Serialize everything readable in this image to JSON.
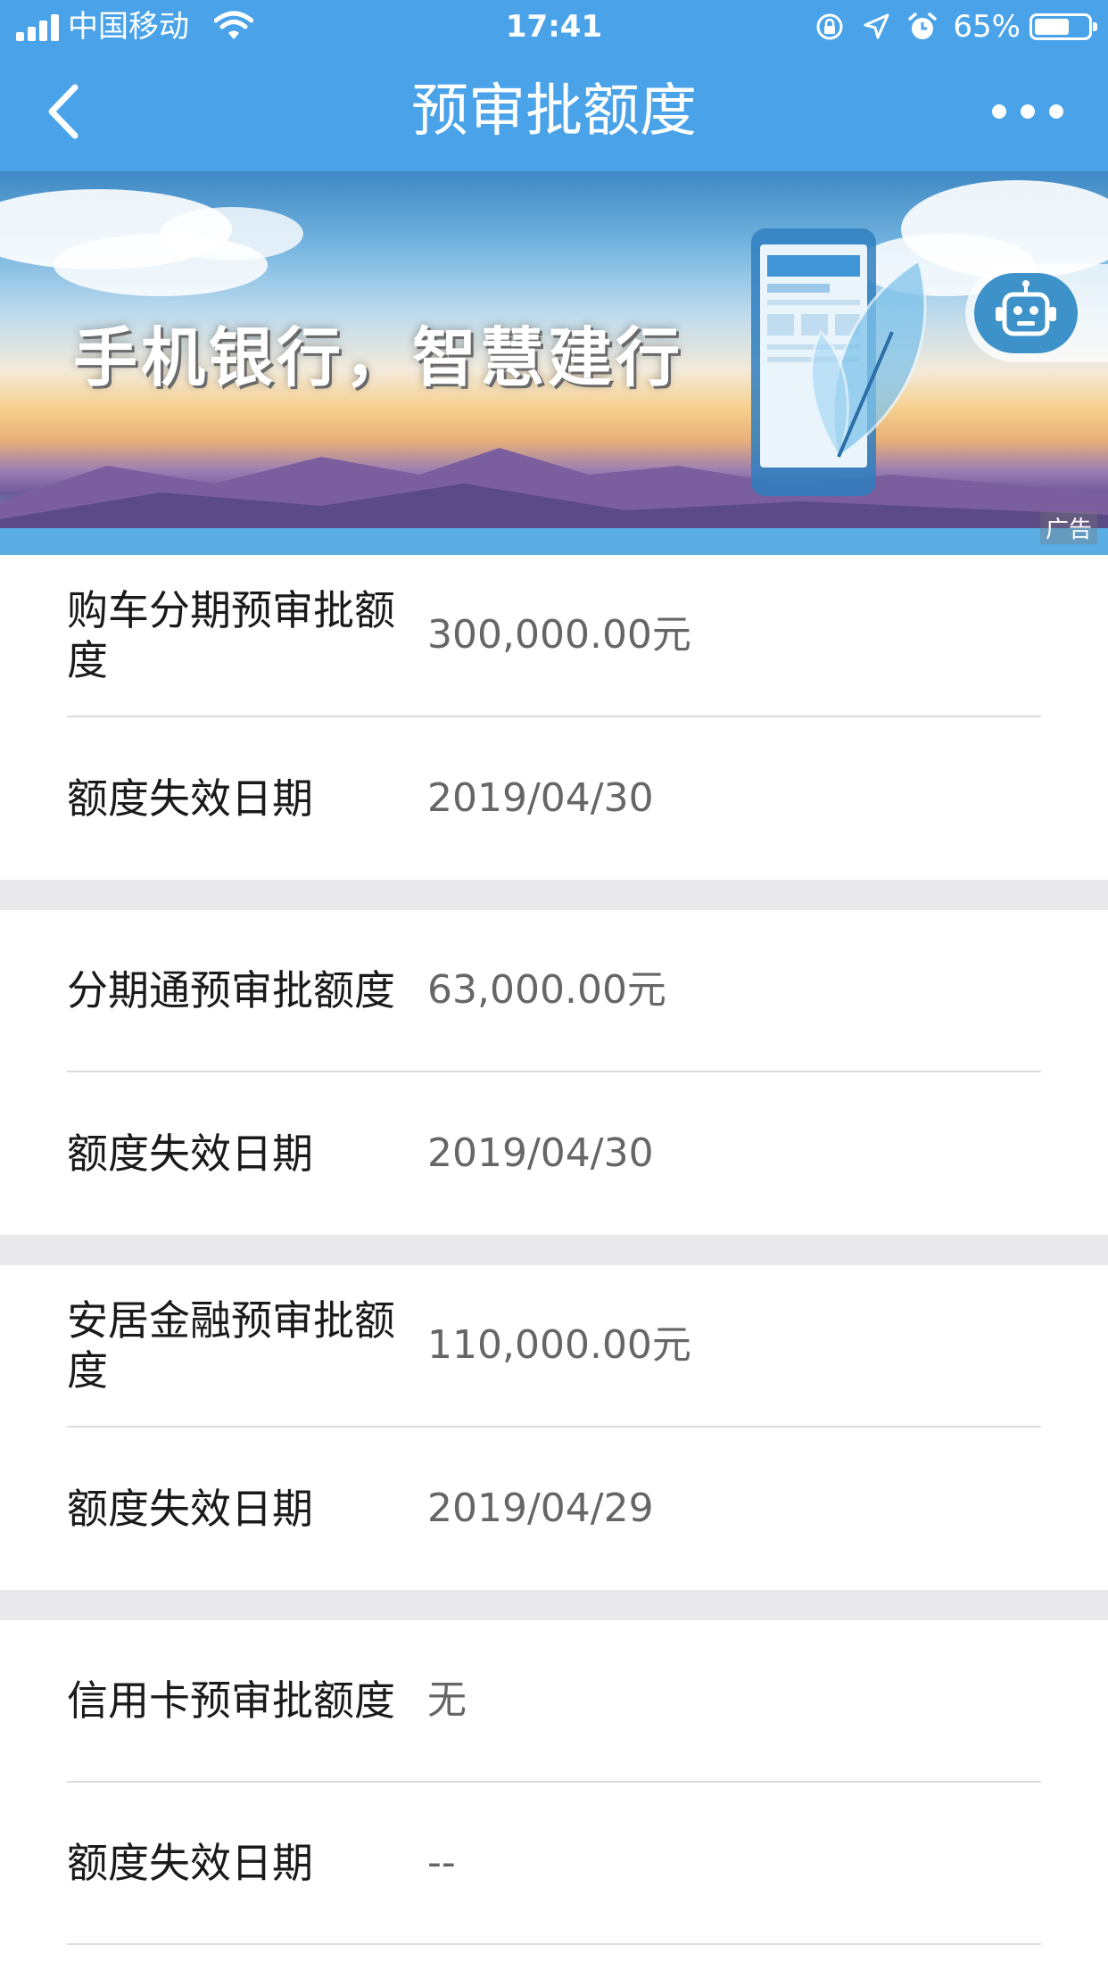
{
  "status_bar": {
    "carrier": "中国移动",
    "time": "17:41",
    "battery": "65%",
    "battery_level": 0.65
  },
  "nav": {
    "title": "预审批额度",
    "back_icon": "chevron-left-icon",
    "more_icon": "more-dots-icon"
  },
  "banner": {
    "slogan": "手机银行，智慧建行",
    "ad_label": "广告",
    "assistant_icon": "robot-icon"
  },
  "groups": [
    {
      "rows": [
        {
          "label": "购车分期预审批额度",
          "value": "300,000.00元"
        },
        {
          "label": "额度失效日期",
          "value": "2019/04/30"
        }
      ]
    },
    {
      "rows": [
        {
          "label": "分期通预审批额度",
          "value": "63,000.00元"
        },
        {
          "label": "额度失效日期",
          "value": "2019/04/30"
        }
      ]
    },
    {
      "rows": [
        {
          "label": "安居金融预审批额度",
          "value": "110,000.00元"
        },
        {
          "label": "额度失效日期",
          "value": "2019/04/29"
        }
      ]
    },
    {
      "rows": [
        {
          "label": "信用卡预审批额度",
          "value": "无"
        },
        {
          "label": "额度失效日期",
          "value": "--"
        }
      ]
    }
  ],
  "colors": {
    "header_bg": "#4aa3e8",
    "group_gap": "#e9e9ec",
    "value_text": "#666666"
  }
}
